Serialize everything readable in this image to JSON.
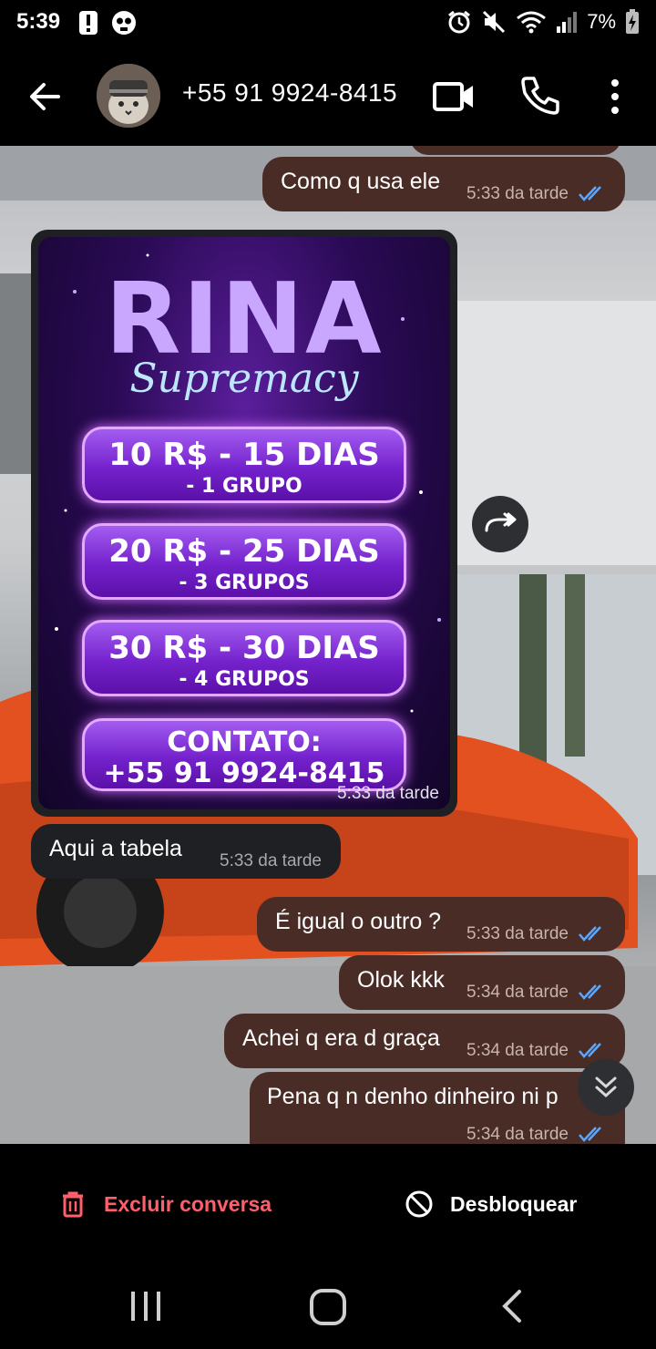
{
  "status_bar": {
    "time": "5:39",
    "battery": "7%"
  },
  "header": {
    "contact_name": "+55 91 9924-8415"
  },
  "messages": [
    {
      "direction": "out",
      "text": "Como q usa ele",
      "time": "5:33 da tarde",
      "status": "read"
    },
    {
      "direction": "in",
      "type": "image",
      "time": "5:33 da tarde"
    },
    {
      "direction": "in",
      "text": "Aqui a tabela",
      "time": "5:33 da tarde"
    },
    {
      "direction": "out",
      "text": "É igual o outro ?",
      "time": "5:33 da tarde",
      "status": "read"
    },
    {
      "direction": "out",
      "text": "Olok kkk",
      "time": "5:34 da tarde",
      "status": "read"
    },
    {
      "direction": "out",
      "text": "Achei q era d graça",
      "time": "5:34 da tarde",
      "status": "read"
    },
    {
      "direction": "out",
      "text": "Pena q n denho dinheiro ni p",
      "time": "5:34 da tarde",
      "status": "read"
    }
  ],
  "promo_image": {
    "title": "RINA",
    "subtitle": "Supremacy",
    "plans": [
      {
        "main": "10 R$ - 15 DIAS",
        "sub": "- 1 GRUPO"
      },
      {
        "main": "20 R$ - 25 DIAS",
        "sub": "- 3 GRUPOS"
      },
      {
        "main": "30 R$ - 30 DIAS",
        "sub": "- 4 GRUPOS"
      },
      {
        "main": "CONTATO:",
        "sub": "+55 91 9924-8415"
      }
    ]
  },
  "actions": {
    "delete_label": "Excluir conversa",
    "unblock_label": "Desbloquear"
  },
  "colors": {
    "outgoing_bubble": "#4a2c27",
    "incoming_bubble": "#1f2023",
    "read_ticks": "#5aa8ff",
    "delete_red": "#ff5f6a"
  }
}
